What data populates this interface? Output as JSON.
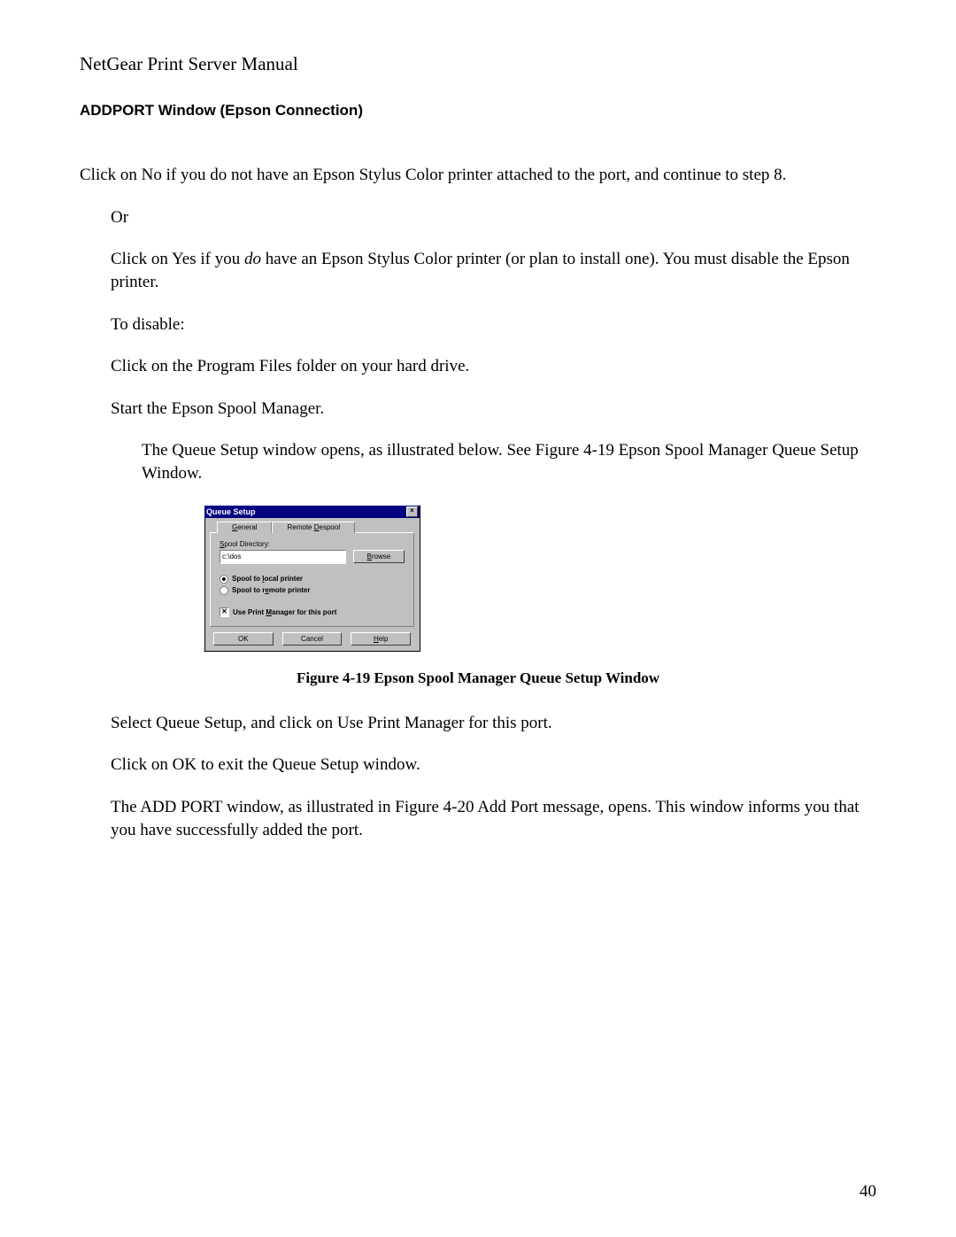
{
  "header": {
    "title": "NetGear Print Server Manual"
  },
  "section": {
    "heading": "ADDPORT Window (Epson Connection)"
  },
  "para": {
    "p1": "Click on No if you do not have an Epson Stylus Color printer attached to the port, and continue to step 8.",
    "p2": "Or",
    "p3a": "Click on Yes if you ",
    "p3_do": "do",
    "p3b": " have an Epson Stylus Color printer (or plan to install one). You must disable the Epson printer.",
    "p4": "To disable:",
    "p5": "Click on the Program Files folder on your hard drive.",
    "p6": "Start the Epson Spool Manager.",
    "p7": "The Queue Setup window opens, as illustrated below. See Figure 4-19 Epson Spool Manager Queue Setup Window.",
    "p8": "Select Queue Setup, and click on Use Print Manager for this port.",
    "p9": "Click on OK to exit the Queue Setup window.",
    "p10": "The ADD PORT window, as illustrated in Figure 4-20 Add Port message, opens. This window informs you that you have successfully added the port."
  },
  "figure": {
    "caption": "Figure 4-19 Epson Spool Manager Queue Setup Window"
  },
  "dialog": {
    "title": "Queue Setup",
    "close": "×",
    "tabs": {
      "general": "General",
      "remote": "Remote Despool"
    },
    "spool_dir_label_pre": "S",
    "spool_dir_label_post": "pool Directory:",
    "spool_dir_value": "c:\\dos",
    "browse_pre": "B",
    "browse_post": "rowse",
    "radio_local_pre": "Spool to ",
    "radio_local_u": "l",
    "radio_local_post": "ocal printer",
    "radio_remote_pre": "Spool to r",
    "radio_remote_u": "e",
    "radio_remote_post": "mote printer",
    "check_pre": "Use Print ",
    "check_u": "M",
    "check_post": "anager for this port",
    "ok": "OK",
    "cancel": "Cancel",
    "help_u": "H",
    "help_post": "elp"
  },
  "page_number": "40"
}
